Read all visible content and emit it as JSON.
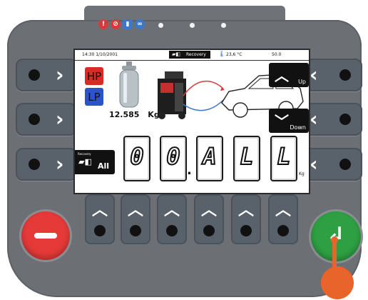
{
  "screen": {
    "status": {
      "time_date": "14:30 1/10/2001",
      "mode_label": "Recovery",
      "temperature": "23,6 °C",
      "value": "50.0"
    },
    "hp_label": "HP",
    "lp_label": "LP",
    "tank_weight": "12.585",
    "weight_unit": "Kg",
    "up_label": "Up",
    "down_label": "Down",
    "all_btn_title": "Recovery",
    "all_label": "All",
    "display_digits": [
      "0",
      "0",
      "A",
      "L",
      "L"
    ],
    "decimal_point": ".",
    "digit_unit": "Kg"
  },
  "top_indicators": {
    "icons": [
      "warning-icon",
      "no-entry-icon",
      "bottle-icon",
      "link-icon"
    ],
    "icon_colors": [
      "#d63b3b",
      "#d63b3b",
      "#3c78c8",
      "#3c78c8"
    ],
    "lights": 3
  },
  "colors": {
    "panel": "#6c6f74",
    "hp": "#d92b25",
    "lp": "#2c54c9",
    "stop": "#e53a38",
    "enter": "#2ea043",
    "marker": "#e8642b"
  }
}
